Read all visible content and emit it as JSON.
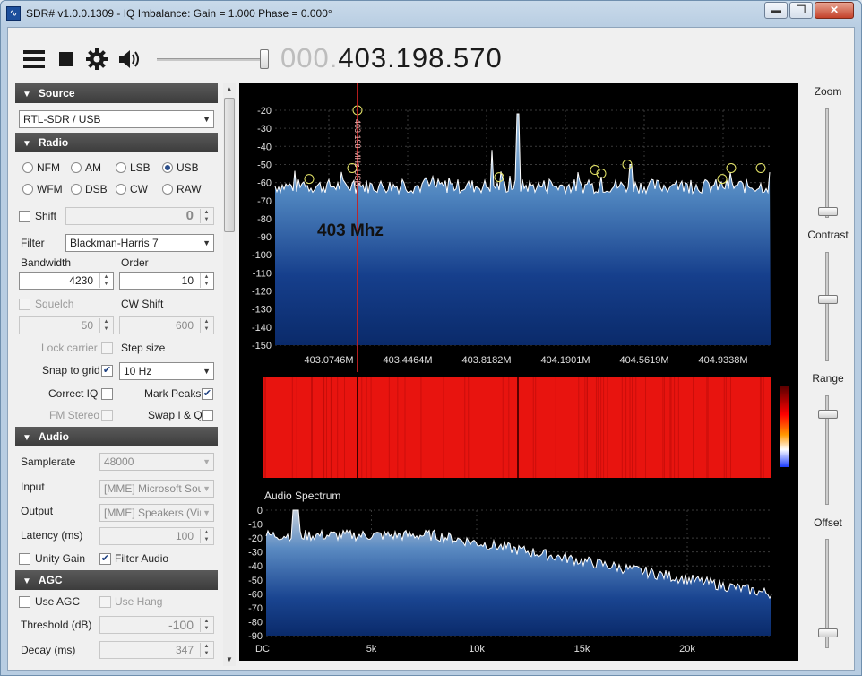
{
  "window": {
    "title": "SDR# v1.0.0.1309 - IQ Imbalance: Gain = 1.000 Phase = 0.000°",
    "minimize_label": "▬",
    "maximize_label": "❐",
    "close_label": "✕"
  },
  "toolbar": {
    "frequency_dim": "000.",
    "frequency_lit": "403.198.570",
    "volume": 0.95
  },
  "source": {
    "header": "Source",
    "device": "RTL-SDR / USB"
  },
  "radio": {
    "header": "Radio",
    "modes": [
      "NFM",
      "AM",
      "LSB",
      "USB",
      "WFM",
      "DSB",
      "CW",
      "RAW"
    ],
    "selected_mode": "USB",
    "shift_label": "Shift",
    "shift_value": "0",
    "filter_label": "Filter",
    "filter_value": "Blackman-Harris 7",
    "bandwidth_label": "Bandwidth",
    "bandwidth_value": "4230",
    "order_label": "Order",
    "order_value": "10",
    "squelch_label": "Squelch",
    "squelch_value": "50",
    "cwshift_label": "CW Shift",
    "cwshift_value": "600",
    "lock_carrier_label": "Lock carrier",
    "step_size_label": "Step size",
    "snap_label": "Snap to grid",
    "snap_value": "10 Hz",
    "correct_iq_label": "Correct IQ",
    "mark_peaks_label": "Mark Peaks",
    "fm_stereo_label": "FM Stereo",
    "swap_iq_label": "Swap I & Q"
  },
  "audio": {
    "header": "Audio",
    "samplerate_label": "Samplerate",
    "samplerate_value": "48000",
    "input_label": "Input",
    "input_value": "[MME] Microsoft Soun",
    "output_label": "Output",
    "output_value": "[MME] Speakers (Virtu",
    "latency_label": "Latency (ms)",
    "latency_value": "100",
    "unity_gain_label": "Unity Gain",
    "filter_audio_label": "Filter Audio"
  },
  "agc": {
    "header": "AGC",
    "use_agc_label": "Use AGC",
    "use_hang_label": "Use Hang",
    "threshold_label": "Threshold (dB)",
    "threshold_value": "-100",
    "decay_label": "Decay (ms)",
    "decay_value": "347"
  },
  "right_controls": {
    "zoom_label": "Zoom",
    "contrast_label": "Contrast",
    "range_label": "Range",
    "offset_label": "Offset"
  },
  "chart_data": [
    {
      "type": "area",
      "y_ticks": [
        "-20",
        "-30",
        "-40",
        "-50",
        "-60",
        "-70",
        "-80",
        "-90",
        "-100",
        "-110",
        "-120",
        "-130",
        "-140",
        "-150"
      ],
      "ylim": [
        -150,
        -20
      ],
      "x_ticks": [
        "403.0746M",
        "403.4464M",
        "403.8182M",
        "404.1901M",
        "404.5619M",
        "404.9338M"
      ],
      "annotation": "403 Mhz",
      "vfo_label": "403.198 MHz USB",
      "noise_floor_db": -62,
      "grid": true,
      "colors": {
        "fill_top": "#a3c2dd",
        "fill_bottom": "#0a2a6a",
        "trace": "#ffffff",
        "marker": "#ff3b3b",
        "peak": "#e8e86a"
      }
    },
    {
      "type": "heatmap",
      "colorbar": [
        "#ff0000",
        "#ff7f00",
        "#ffffff",
        "#1a3cff"
      ]
    },
    {
      "type": "area",
      "title": "Audio Spectrum",
      "y_ticks": [
        "0",
        "-10",
        "-20",
        "-30",
        "-40",
        "-50",
        "-60",
        "-70",
        "-80",
        "-90"
      ],
      "ylim": [
        -90,
        0
      ],
      "x_ticks": [
        "DC",
        "5k",
        "10k",
        "15k",
        "20k"
      ],
      "xlim": [
        0,
        24000
      ],
      "grid": true
    }
  ]
}
